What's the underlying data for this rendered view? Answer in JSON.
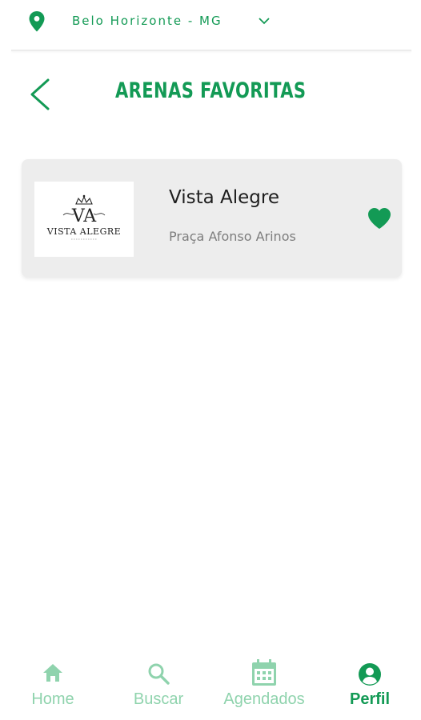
{
  "location": {
    "city": "Belo Horizonte - MG",
    "pin_icon": "map-pin-icon",
    "chevron_icon": "chevron-down-icon"
  },
  "header": {
    "title": "ARENAS FAVORITAS",
    "back_icon": "chevron-left-icon"
  },
  "favorites": [
    {
      "name": "Vista Alegre",
      "address": "Praça Afonso Arinos",
      "logo_text": "VISTA ALEGRE",
      "logo_monogram": "VA",
      "favorite_icon": "heart-icon",
      "favorited": true
    }
  ],
  "bottom_nav": {
    "items": [
      {
        "label": "Home",
        "icon": "home-icon",
        "active": false
      },
      {
        "label": "Buscar",
        "icon": "search-icon",
        "active": false
      },
      {
        "label": "Agendados",
        "icon": "calendar-icon",
        "active": false
      },
      {
        "label": "Perfil",
        "icon": "profile-icon",
        "active": true
      }
    ]
  },
  "colors": {
    "primary": "#139a55",
    "inactive_nav": "#8fd3ad",
    "card_bg": "#ededed",
    "text_dark": "#1e1e1e",
    "text_muted": "#7d7d7d"
  }
}
